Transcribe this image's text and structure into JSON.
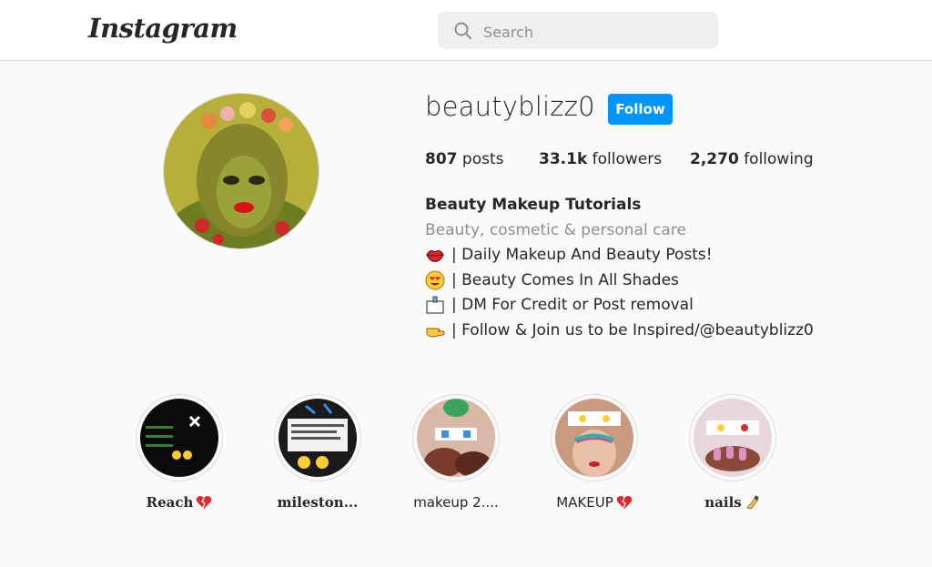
{
  "header": {
    "logo_text": "Instagram",
    "search_placeholder": "Search"
  },
  "profile": {
    "username": "beautyblizz0",
    "follow_label": "Follow",
    "stats": {
      "posts_count": "807",
      "posts_label": "posts",
      "followers_count": "33.1k",
      "followers_label": "followers",
      "following_count": "2,270",
      "following_label": "following"
    },
    "bio": {
      "name": "Beauty Makeup Tutorials",
      "category": "Beauty, cosmetic & personal care",
      "lines": [
        {
          "icon": "lips-icon",
          "text": "| Daily Makeup And Beauty Posts!"
        },
        {
          "icon": "heart-eyes-icon",
          "text": "| Beauty Comes In All Shades"
        },
        {
          "icon": "envelope-icon",
          "text": "| DM For Credit or Post removal"
        },
        {
          "icon": "pointing-hand-icon",
          "text": "| Follow & Join us to be Inspired/@beautyblizz0"
        }
      ]
    }
  },
  "highlights": [
    {
      "label": "Reach",
      "emoji": "broken-heart-icon"
    },
    {
      "label": "mileston..."
    },
    {
      "label": "makeup 2...."
    },
    {
      "label": "MAKEUP",
      "emoji": "broken-heart-icon"
    },
    {
      "label": "nails",
      "emoji": "nail-polish-icon"
    }
  ],
  "colors": {
    "follow_button": "#0095f6",
    "secondary_text": "#8e8e8e",
    "border": "#dbdbdb"
  }
}
